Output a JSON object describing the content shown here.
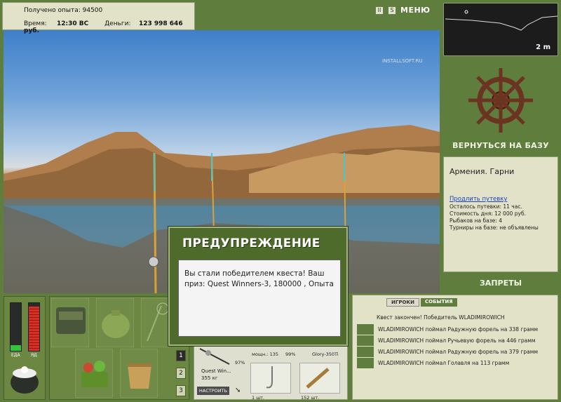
{
  "top_info": {
    "exp_label": "Получено опыта:",
    "exp_value": "94500",
    "time_label": "Время:",
    "time_value": "12:30 ВС",
    "money_label": "Деньги:",
    "money_value": "123 998 646 руб."
  },
  "toolbar": {
    "pause_label": "II",
    "sound_label": "S",
    "menu_label": "МЕНЮ"
  },
  "watermark": "INSTALLSOFT.RU",
  "minimap": {
    "depth": "2 m"
  },
  "base": {
    "return_label": "ВЕРНУТЬСЯ НА БАЗУ"
  },
  "location": {
    "name": "Армения. Гарни",
    "extend_link": "Продлить путевку",
    "remaining": "Осталось путевки: 11 час.",
    "day_cost": "Стоимость дня: 12 000 руб.",
    "fishers": "Рыбаков на базе: 4",
    "tournaments": "Турниры на базе: не объявлены"
  },
  "rules_label": "ЗАПРЕТЫ",
  "gauges": {
    "food_label": "ЕДА",
    "poison_label": "ЯД",
    "food_level": 0.12,
    "poison_level": 0.92
  },
  "inventory": {
    "pages": [
      "1",
      "2",
      "3"
    ],
    "active_page": "1"
  },
  "tackle": {
    "rod_name": "Quest Win...",
    "rod_weight": "355 кг",
    "rod_pct": "97%",
    "line_label": "мощн.: 135",
    "line_pct": "99%",
    "reel_label": "Glory-350Ti",
    "hook_count": "1 шт.",
    "bait_count": "152 шт.",
    "setup_label": "НАСТРОИТЬ"
  },
  "dialog": {
    "title": "ПРЕДУПРЕЖДЕНИЕ",
    "message": "Вы стали победителем квеста! Ваш приз: Quest Winners-3, 180000 , Опыта"
  },
  "events": {
    "tab_players": "ИГРОКИ",
    "tab_events": "СОБЫТИЯ",
    "header": "Квест закончен! Победитель WLADIMIROWICH",
    "items": [
      "WLADIMIROWICH поймал Радужную форель на 338 грамм",
      "WLADIMIROWICH поймал Ручьевую форель на 446 грамм",
      "WLADIMIROWICH поймал Радужную форель на 379 грамм",
      "WLADIMIROWICH поймал Голавля на 113 грамм"
    ]
  }
}
